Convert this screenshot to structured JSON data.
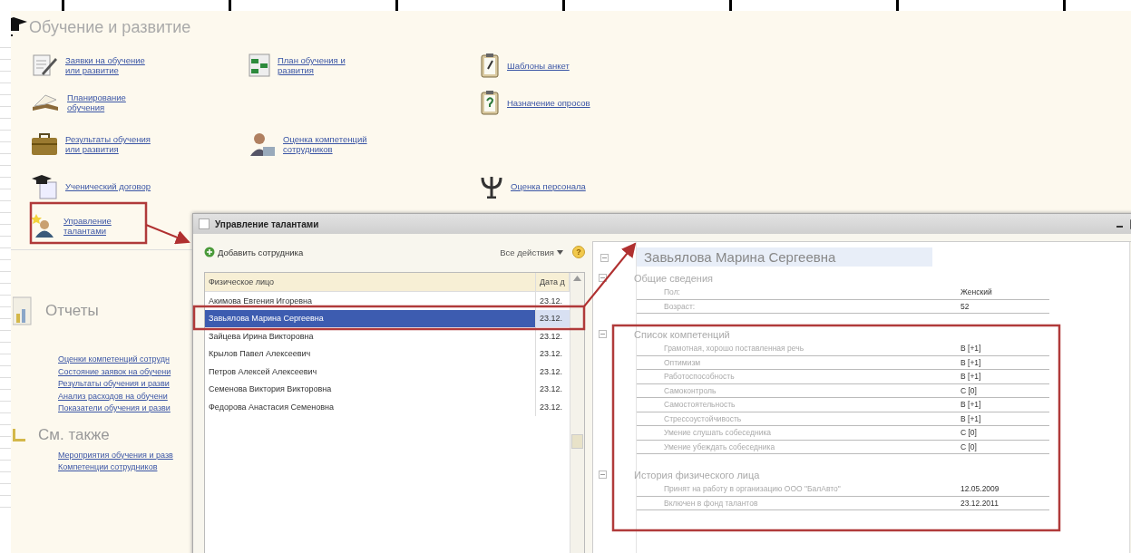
{
  "section": {
    "title": "Обучение и развитие",
    "links": [
      {
        "label": "Заявки на обучение или развитие"
      },
      {
        "label": "План обучения и развития"
      },
      {
        "label": "Шаблоны анкет"
      },
      {
        "label": "Планирование обучения"
      },
      {
        "label": "Назначение опросов"
      },
      {
        "label": "Результаты обучения или развития"
      },
      {
        "label": "Оценка компетенций сотрудников"
      },
      {
        "label": "Ученический договор"
      },
      {
        "label": "Оценка персонала"
      },
      {
        "label": "Управление талантами"
      }
    ]
  },
  "reports": {
    "title": "Отчеты",
    "links": [
      "Оценки компетенций сотрудн",
      "Состояние заявок на обучени",
      "Результаты обучения и разви",
      "Анализ расходов на обучени",
      "Показатели обучения и разви"
    ]
  },
  "see_also": {
    "title": "См. также",
    "links": [
      "Мероприятия обучения и разв",
      "Компетенции сотрудников"
    ]
  },
  "window": {
    "title": "Управление талантами",
    "toolbar": {
      "add": "Добавить сотрудника",
      "all_actions": "Все действия",
      "help": "?"
    },
    "table": {
      "columns": [
        "Физическое лицо",
        "Дата д"
      ],
      "rows": [
        {
          "cells": [
            "Акимова Евгения Игоревна",
            "23.12."
          ],
          "selected": false
        },
        {
          "cells": [
            "Завьялова Марина Сергеевна",
            "23.12."
          ],
          "selected": true
        },
        {
          "cells": [
            "Зайцева Ирина Викторовна",
            "23.12."
          ],
          "selected": false
        },
        {
          "cells": [
            "Крылов Павел Алексеевич",
            "23.12."
          ],
          "selected": false
        },
        {
          "cells": [
            "Петров Алексей Алексеевич",
            "23.12."
          ],
          "selected": false
        },
        {
          "cells": [
            "Семенова Виктория Викторовна",
            "23.12."
          ],
          "selected": false
        },
        {
          "cells": [
            "Федорова Анастасия Семеновна",
            "23.12."
          ],
          "selected": false
        }
      ]
    },
    "details": {
      "name": "Завьялова Марина Сергеевна",
      "groups": [
        {
          "title": "Общие сведения",
          "rows": [
            {
              "label": "Пол:",
              "value": "Женский"
            },
            {
              "label": "Возраст:",
              "value": "52"
            }
          ]
        },
        {
          "title": "Список компетенций",
          "rows": [
            {
              "label": "Грамотная, хорошо поставленная речь",
              "value": "B [+1]"
            },
            {
              "label": "Оптимизм",
              "value": "B [+1]"
            },
            {
              "label": "Работоспособность",
              "value": "B [+1]"
            },
            {
              "label": "Самоконтроль",
              "value": "C [0]"
            },
            {
              "label": "Самостоятельность",
              "value": "B [+1]"
            },
            {
              "label": "Стрессоустойчивость",
              "value": "B [+1]"
            },
            {
              "label": "Умение слушать собеседника",
              "value": "C [0]"
            },
            {
              "label": "Умение убеждать собеседника",
              "value": "C [0]"
            }
          ]
        },
        {
          "title": "История физического лица",
          "rows": [
            {
              "label": "Принят на работу в организацию ООО \"БалАвто\"",
              "value": "12.05.2009"
            },
            {
              "label": "Включен в фонд талантов",
              "value": "23.12.2011"
            }
          ]
        }
      ]
    }
  }
}
